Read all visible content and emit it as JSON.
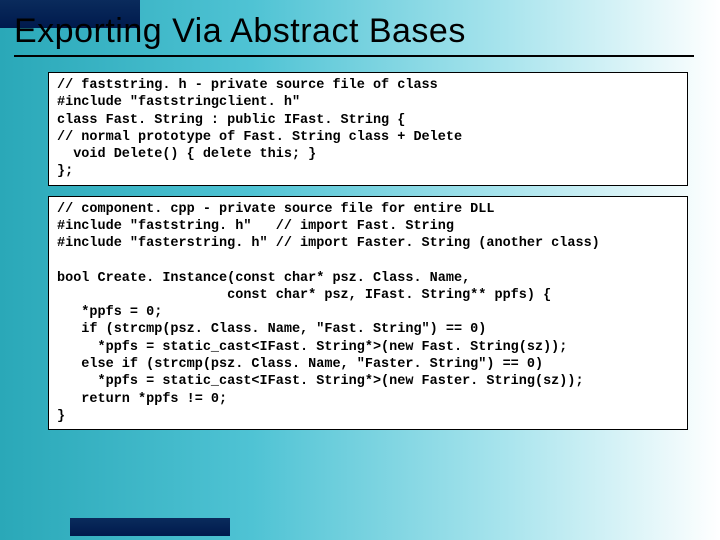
{
  "title": "Exporting Via Abstract Bases",
  "code_box_1": "// faststring. h - private source file of class\n#include \"faststringclient. h\"\nclass Fast. String : public IFast. String {\n// normal prototype of Fast. String class + Delete\n  void Delete() { delete this; }\n};",
  "code_box_2": "// component. cpp - private source file for entire DLL\n#include \"faststring. h\"   // import Fast. String\n#include \"fasterstring. h\" // import Faster. String (another class)\n\nbool Create. Instance(const char* psz. Class. Name,\n                     const char* psz, IFast. String** ppfs) {\n   *ppfs = 0;\n   if (strcmp(psz. Class. Name, \"Fast. String\") == 0)\n     *ppfs = static_cast<IFast. String*>(new Fast. String(sz));\n   else if (strcmp(psz. Class. Name, \"Faster. String\") == 0)\n     *ppfs = static_cast<IFast. String*>(new Faster. String(sz));\n   return *ppfs != 0;\n}"
}
